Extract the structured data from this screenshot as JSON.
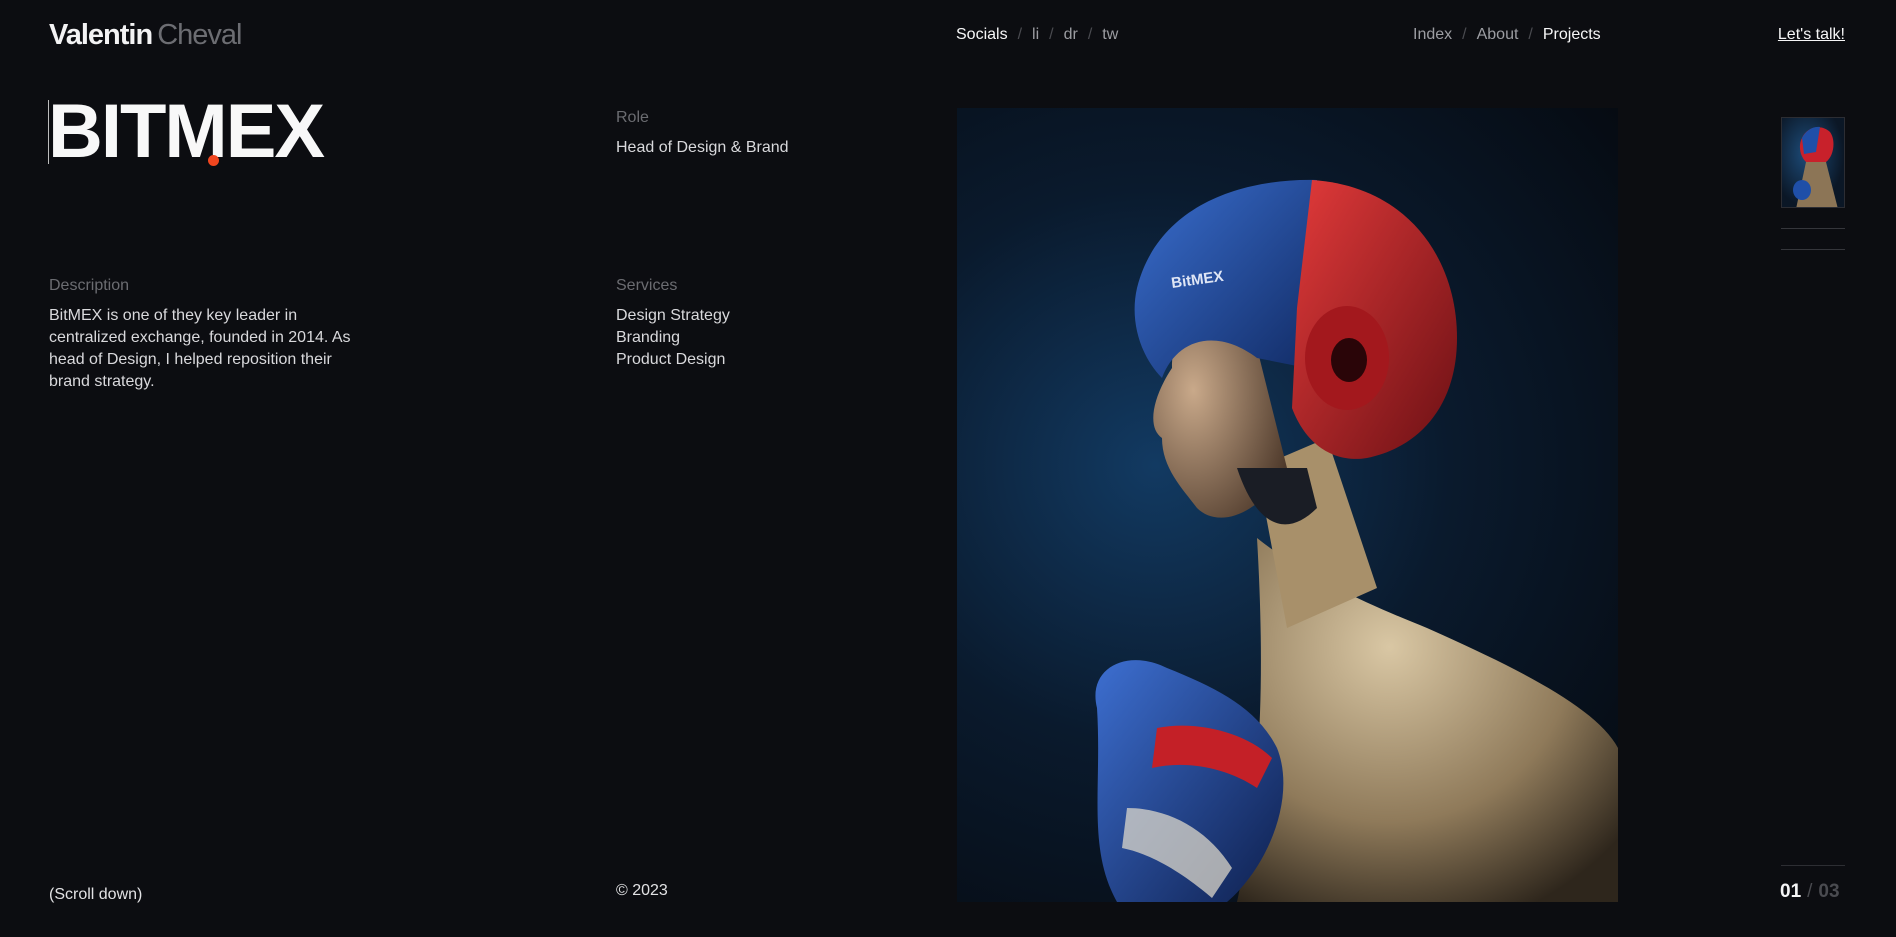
{
  "header": {
    "logo_first": "Valentin",
    "logo_last": "Cheval",
    "socials": [
      "Socials",
      "li",
      "dr",
      "tw"
    ],
    "nav": [
      "Index",
      "About",
      "Projects"
    ],
    "separator": "/",
    "cta": "Let's talk!"
  },
  "project": {
    "title": "BITMEX",
    "role_label": "Role",
    "role_value": "Head of Design & Brand",
    "description_label": "Description",
    "description": "BitMEX is one of they key leader in centralized exchange, founded in 2014. As head of Design, I helped reposition their brand strategy.",
    "services_label": "Services",
    "services": [
      "Design Strategy",
      "Branding",
      "Product Design"
    ],
    "helmet_logo_text": "BitMEX"
  },
  "footer": {
    "scroll": "(Scroll down)",
    "copyright": "© 2023",
    "counter_current": "01",
    "counter_separator": "/",
    "counter_total": "03"
  },
  "colors": {
    "background": "#0c0d11",
    "accent_dot": "#f1461f",
    "helmet_red": "#c8212b",
    "helmet_blue": "#1f4fa8"
  }
}
